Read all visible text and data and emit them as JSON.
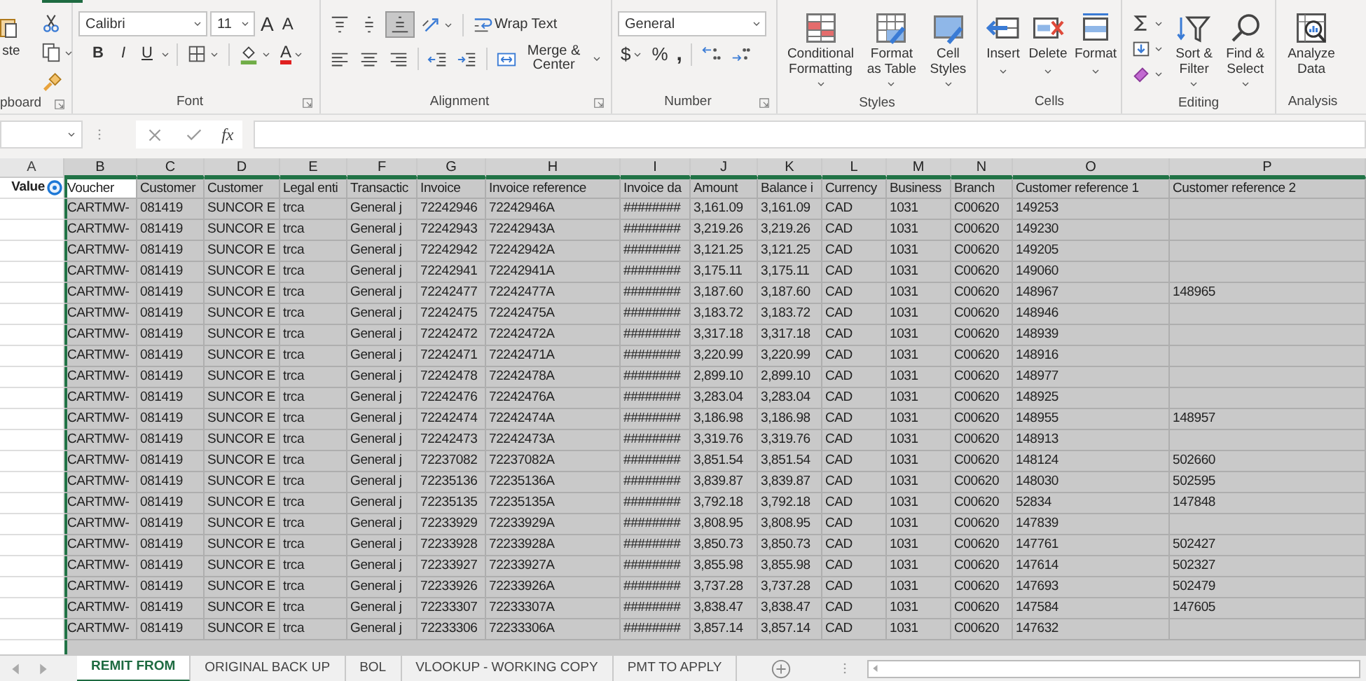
{
  "ribbon": {
    "clipboard": {
      "paste_label": "ste",
      "group_label": "pboard"
    },
    "font": {
      "font_name": "Calibri",
      "font_size": "11",
      "grow": "A",
      "shrink": "A",
      "bold": "B",
      "italic": "I",
      "underline": "U",
      "font_color": "A",
      "group_label": "Font"
    },
    "alignment": {
      "bottom_align_selected": true,
      "wrap_text": "Wrap Text",
      "merge_center": "Merge & Center",
      "group_label": "Alignment"
    },
    "number": {
      "format": "General",
      "currency": "$",
      "percent": "%",
      "comma": ",",
      "group_label": "Number"
    },
    "styles": {
      "buttons": [
        "Conditional Formatting",
        "Format as Table",
        "Cell Styles"
      ],
      "group_label": "Styles"
    },
    "cells": {
      "buttons": [
        "Insert",
        "Delete",
        "Format"
      ],
      "group_label": "Cells"
    },
    "editing": {
      "buttons": [
        "Sort & Filter",
        "Find & Select"
      ],
      "group_label": "Editing"
    },
    "analysis": {
      "buttons": [
        "Analyze Data"
      ],
      "group_label": "Analysis"
    }
  },
  "formula_bar": {
    "fx": "fx"
  },
  "sheet": {
    "column_letters": [
      "A",
      "B",
      "C",
      "D",
      "E",
      "F",
      "G",
      "H",
      "I",
      "J",
      "K",
      "L",
      "M",
      "N",
      "O",
      "P"
    ],
    "a1": "Value",
    "headers": [
      "Voucher",
      "Customer",
      "Customer",
      "Legal enti",
      "Transactic",
      "Invoice",
      "Invoice reference",
      "Invoice da",
      "Amount",
      "Balance i",
      "Currency",
      "Business",
      "Branch",
      "Customer reference 1",
      "Customer reference 2"
    ],
    "rows": [
      {
        "cells": [
          "CARTMW-",
          "081419",
          "SUNCOR E",
          "trca",
          "General j",
          "72242946",
          "72242946A",
          "########",
          "3,161.09",
          "3,161.09",
          "CAD",
          "1031",
          "C00620",
          "149253"
        ]
      },
      {
        "cells": [
          "CARTMW-",
          "081419",
          "SUNCOR E",
          "trca",
          "General j",
          "72242943",
          "72242943A",
          "########",
          "3,219.26",
          "3,219.26",
          "CAD",
          "1031",
          "C00620",
          "149230"
        ]
      },
      {
        "cells": [
          "CARTMW-",
          "081419",
          "SUNCOR E",
          "trca",
          "General j",
          "72242942",
          "72242942A",
          "########",
          "3,121.25",
          "3,121.25",
          "CAD",
          "1031",
          "C00620",
          "149205"
        ]
      },
      {
        "cells": [
          "CARTMW-",
          "081419",
          "SUNCOR E",
          "trca",
          "General j",
          "72242941",
          "72242941A",
          "########",
          "3,175.11",
          "3,175.11",
          "CAD",
          "1031",
          "C00620",
          "149060"
        ]
      },
      {
        "cells": [
          "CARTMW-",
          "081419",
          "SUNCOR E",
          "trca",
          "General j",
          "72242477",
          "72242477A",
          "########",
          "3,187.60",
          "3,187.60",
          "CAD",
          "1031",
          "C00620",
          "148967"
        ],
        "ref2": "148965"
      },
      {
        "cells": [
          "CARTMW-",
          "081419",
          "SUNCOR E",
          "trca",
          "General j",
          "72242475",
          "72242475A",
          "########",
          "3,183.72",
          "3,183.72",
          "CAD",
          "1031",
          "C00620",
          "148946"
        ]
      },
      {
        "cells": [
          "CARTMW-",
          "081419",
          "SUNCOR E",
          "trca",
          "General j",
          "72242472",
          "72242472A",
          "########",
          "3,317.18",
          "3,317.18",
          "CAD",
          "1031",
          "C00620",
          "148939"
        ]
      },
      {
        "cells": [
          "CARTMW-",
          "081419",
          "SUNCOR E",
          "trca",
          "General j",
          "72242471",
          "72242471A",
          "########",
          "3,220.99",
          "3,220.99",
          "CAD",
          "1031",
          "C00620",
          "148916"
        ]
      },
      {
        "cells": [
          "CARTMW-",
          "081419",
          "SUNCOR E",
          "trca",
          "General j",
          "72242478",
          "72242478A",
          "########",
          "2,899.10",
          "2,899.10",
          "CAD",
          "1031",
          "C00620",
          "148977"
        ]
      },
      {
        "cells": [
          "CARTMW-",
          "081419",
          "SUNCOR E",
          "trca",
          "General j",
          "72242476",
          "72242476A",
          "########",
          "3,283.04",
          "3,283.04",
          "CAD",
          "1031",
          "C00620",
          "148925"
        ]
      },
      {
        "cells": [
          "CARTMW-",
          "081419",
          "SUNCOR E",
          "trca",
          "General j",
          "72242474",
          "72242474A",
          "########",
          "3,186.98",
          "3,186.98",
          "CAD",
          "1031",
          "C00620",
          "148955"
        ],
        "ref2": "148957"
      },
      {
        "cells": [
          "CARTMW-",
          "081419",
          "SUNCOR E",
          "trca",
          "General j",
          "72242473",
          "72242473A",
          "########",
          "3,319.76",
          "3,319.76",
          "CAD",
          "1031",
          "C00620",
          "148913"
        ]
      },
      {
        "cells": [
          "CARTMW-",
          "081419",
          "SUNCOR E",
          "trca",
          "General j",
          "72237082",
          "72237082A",
          "########",
          "3,851.54",
          "3,851.54",
          "CAD",
          "1031",
          "C00620",
          "148124"
        ],
        "ref2": "502660"
      },
      {
        "cells": [
          "CARTMW-",
          "081419",
          "SUNCOR E",
          "trca",
          "General j",
          "72235136",
          "72235136A",
          "########",
          "3,839.87",
          "3,839.87",
          "CAD",
          "1031",
          "C00620",
          "148030"
        ],
        "ref2": "502595"
      },
      {
        "cells": [
          "CARTMW-",
          "081419",
          "SUNCOR E",
          "trca",
          "General j",
          "72235135",
          "72235135A",
          "########",
          "3,792.18",
          "3,792.18",
          "CAD",
          "1031",
          "C00620",
          "52834"
        ],
        "ref2": "147848"
      },
      {
        "cells": [
          "CARTMW-",
          "081419",
          "SUNCOR E",
          "trca",
          "General j",
          "72233929",
          "72233929A",
          "########",
          "3,808.95",
          "3,808.95",
          "CAD",
          "1031",
          "C00620",
          "147839"
        ]
      },
      {
        "cells": [
          "CARTMW-",
          "081419",
          "SUNCOR E",
          "trca",
          "General j",
          "72233928",
          "72233928A",
          "########",
          "3,850.73",
          "3,850.73",
          "CAD",
          "1031",
          "C00620",
          "147761"
        ],
        "ref2": "502427"
      },
      {
        "cells": [
          "CARTMW-",
          "081419",
          "SUNCOR E",
          "trca",
          "General j",
          "72233927",
          "72233927A",
          "########",
          "3,855.98",
          "3,855.98",
          "CAD",
          "1031",
          "C00620",
          "147614"
        ],
        "ref2": "502327"
      },
      {
        "cells": [
          "CARTMW-",
          "081419",
          "SUNCOR E",
          "trca",
          "General j",
          "72233926",
          "72233926A",
          "########",
          "3,737.28",
          "3,737.28",
          "CAD",
          "1031",
          "C00620",
          "147693"
        ],
        "ref2": "502479"
      },
      {
        "cells": [
          "CARTMW-",
          "081419",
          "SUNCOR E",
          "trca",
          "General j",
          "72233307",
          "72233307A",
          "########",
          "3,838.47",
          "3,838.47",
          "CAD",
          "1031",
          "C00620",
          "147584"
        ],
        "ref2": "147605"
      },
      {
        "cells": [
          "CARTMW-",
          "081419",
          "SUNCOR E",
          "trca",
          "General j",
          "72233306",
          "72233306A",
          "########",
          "3,857.14",
          "3,857.14",
          "CAD",
          "1031",
          "C00620",
          "147632"
        ]
      }
    ]
  },
  "sheet_tabs": [
    {
      "label": "REMIT FROM",
      "selected": true
    },
    {
      "label": "ORIGINAL BACK UP",
      "selected": false
    },
    {
      "label": "BOL",
      "selected": false
    },
    {
      "label": "VLOOKUP - WORKING COPY",
      "selected": false
    },
    {
      "label": "PMT TO APPLY",
      "selected": false
    }
  ]
}
